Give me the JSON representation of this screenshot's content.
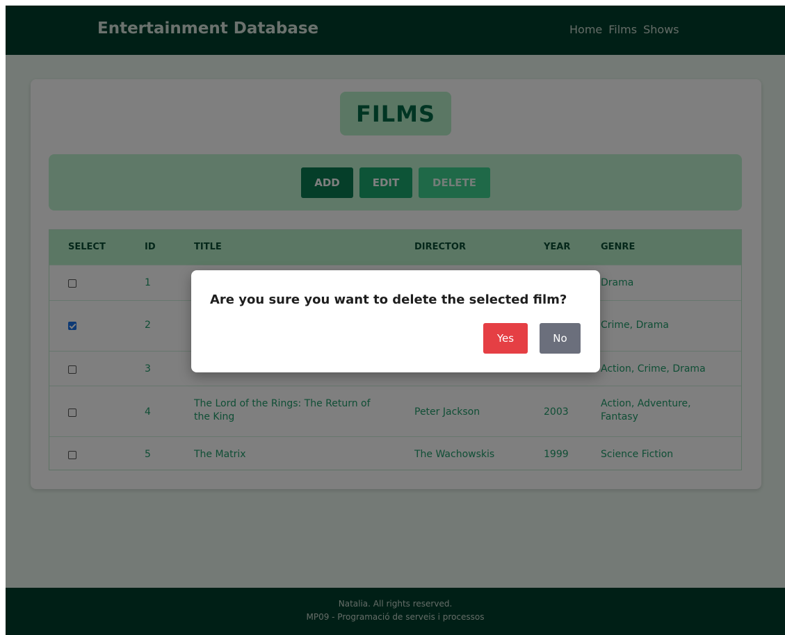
{
  "header": {
    "brand": "Entertainment Database",
    "nav": [
      "Home",
      "Films",
      "Shows"
    ]
  },
  "page_title": "FILMS",
  "toolbar": {
    "add_label": "ADD",
    "edit_label": "EDIT",
    "delete_label": "DELETE"
  },
  "table": {
    "columns": [
      "SELECT",
      "ID",
      "TITLE",
      "DIRECTOR",
      "YEAR",
      "GENRE"
    ],
    "rows": [
      {
        "id": "1",
        "title": "",
        "director": "",
        "year": "",
        "genre": "Drama",
        "checked": false
      },
      {
        "id": "2",
        "title": "",
        "director": "",
        "year": "",
        "genre": "Crime, Drama",
        "checked": true
      },
      {
        "id": "3",
        "title": "",
        "director": "",
        "year": "",
        "genre": "Action, Crime, Drama",
        "checked": false
      },
      {
        "id": "4",
        "title": "The Lord of the Rings: The Return of the King",
        "director": "Peter Jackson",
        "year": "2003",
        "genre": "Action, Adventure, Fantasy",
        "checked": false
      },
      {
        "id": "5",
        "title": "The Matrix",
        "director": "The Wachowskis",
        "year": "1999",
        "genre": "Science Fiction",
        "checked": false
      }
    ]
  },
  "modal": {
    "message": "Are you sure you want to delete the selected film?",
    "yes_label": "Yes",
    "no_label": "No"
  },
  "footer": {
    "line1": "Natalia. All rights reserved.",
    "line2": "MP09 - Programació de serveis i processos"
  },
  "colors": {
    "header_bg": "#003f2c",
    "accent": "#0b7d52",
    "danger": "#e53f44"
  }
}
